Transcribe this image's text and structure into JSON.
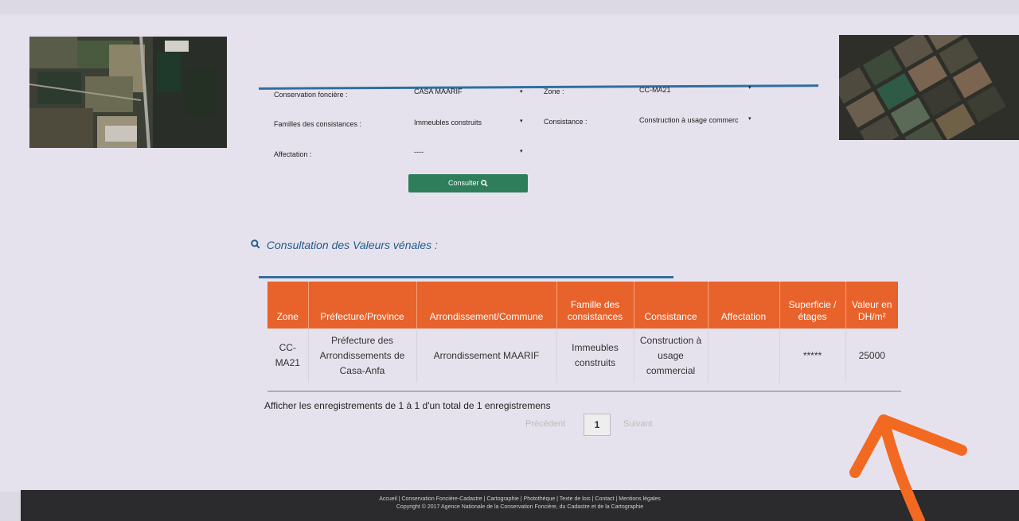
{
  "form": {
    "conservation_label": "Conservation foncière :",
    "conservation_value": "CASA MAARIF",
    "zone_label": "Zone :",
    "zone_value": "CC-MA21",
    "familles_label": "Familles des consistances :",
    "familles_value": "Immeubles construits",
    "consistance_label": "Consistance :",
    "consistance_value": "Construction à usage commerc",
    "affectation_label": "Affectation :",
    "affectation_value": "----",
    "consulter_label": "Consulter"
  },
  "section_title": "Consultation des Valeurs vénales :",
  "table": {
    "headers": [
      "Zone",
      "Préfecture/Province",
      "Arrondissement/Commune",
      "Famille des consistances",
      "Consistance",
      "Affectation",
      "Superficie / étages",
      "Valeur en DH/m²"
    ],
    "rows": [
      [
        "CC-MA21",
        "Préfecture des Arrondissements de Casa-Anfa",
        "Arrondissement MAARIF",
        "Immeubles construits",
        "Construction à usage commercial",
        "",
        "*****",
        "25000"
      ]
    ]
  },
  "info_text": "Afficher les enregistrements de 1 à 1 d'un total de 1 enregistremens",
  "pagination": {
    "prev_label": "Précédent",
    "current_page": "1",
    "next_label": "Suivant"
  },
  "footer": {
    "links": "Accueil | Conservation Foncière-Cadastre | Cartographie | Photothèque | Texte de lois | Contact | Mentions légales",
    "copyright": "Copyright © 2017 Agence Nationale de la Conservation Foncière, du Cadastre et de la Cartographie"
  },
  "colors": {
    "accent_orange": "#e8622c",
    "button_green": "#2e7d5b",
    "rule_blue": "#2f6f9f",
    "title_blue": "#1f5b8a",
    "annotation_arrow": "#f26a21"
  }
}
